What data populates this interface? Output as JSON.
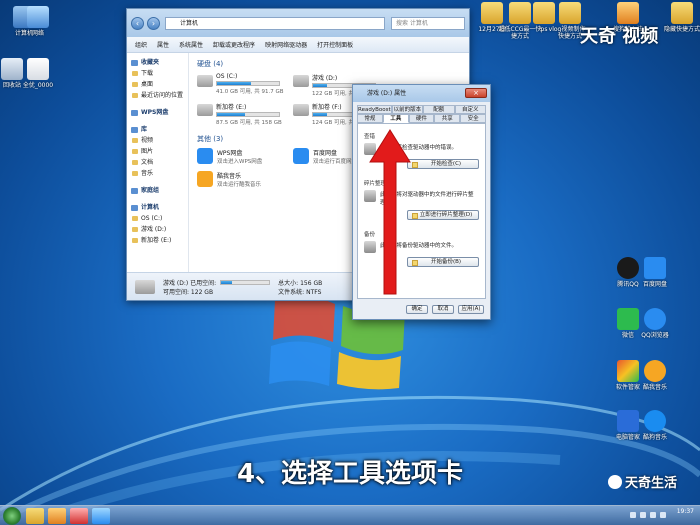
{
  "desktop": {
    "left_icons": [
      {
        "label": "计算机"
      },
      {
        "label": "网络"
      },
      {
        "label": "回收站"
      },
      {
        "label": "全优_0000"
      }
    ],
    "top_icons": [
      {
        "label": "12月27日"
      },
      {
        "label": "超低CCG最一快捷方式"
      },
      {
        "label": "ps"
      },
      {
        "label": "vlog视频制作一快捷方式"
      },
      {
        "label": "搜狗输入法"
      },
      {
        "label": "隐藏快捷方式"
      }
    ],
    "right_icons": [
      {
        "label": "腾讯QQ",
        "color": "#1a1a1a"
      },
      {
        "label": "百度网盘",
        "color": "#2a8cf0"
      },
      {
        "label": "微信",
        "color": "#2dbb4e"
      },
      {
        "label": "QQ浏览器",
        "color": "#2a8cf0"
      },
      {
        "label": "软件管家",
        "color": "#e7562e"
      },
      {
        "label": "酷我音乐",
        "color": "#f6a623"
      },
      {
        "label": "电脑管家",
        "color": "#2a6cd8"
      },
      {
        "label": "酷狗音乐",
        "color": "#1a8cf0"
      }
    ]
  },
  "explorer": {
    "address": "计算机",
    "search_placeholder": "搜索 计算机",
    "toolbar": [
      "组织",
      "属性",
      "系统属性",
      "卸载或更改程序",
      "映射网络驱动器",
      "打开控制面板"
    ],
    "sidebar": {
      "favorites_header": "收藏夹",
      "favorites": [
        "下载",
        "桌面",
        "最近访问的位置"
      ],
      "wps": "WPS网盘",
      "libraries_header": "库",
      "libraries": [
        "视频",
        "图片",
        "文档",
        "音乐"
      ],
      "homegroup": "家庭组",
      "computer_header": "计算机",
      "computer": [
        "OS (C:)",
        "游戏 (D:)",
        "新加卷 (E:)"
      ]
    },
    "drives_group": "硬盘 (4)",
    "drives": [
      {
        "name": "OS (C:)",
        "free": "41.0 GB 可用, 共 91.7 GB",
        "usage": 0.55,
        "red": false
      },
      {
        "name": "游戏 (D:)",
        "free": "122 GB 可用, 共 156 GB",
        "usage": 0.22,
        "red": false
      },
      {
        "name": "新加卷 (E:)",
        "free": "87.5 GB 可用, 共 158 GB",
        "usage": 0.45,
        "red": false
      },
      {
        "name": "新加卷 (F:)",
        "free": "124 GB 可用, 共 158 GB",
        "usage": 0.22,
        "red": false
      }
    ],
    "others_group": "其他 (3)",
    "others": [
      {
        "name": "WPS网盘",
        "sub": "双击进入WPS网盘",
        "color": "#2a8cf0"
      },
      {
        "name": "百度网盘",
        "sub": "双击运行百度网盘",
        "color": "#2a8cf0"
      },
      {
        "name": "酷我音乐",
        "sub": "双击运行酷我音乐",
        "color": "#f6a623"
      }
    ],
    "status": {
      "drive": "游戏 (D:) 已用空间:",
      "free": "可用空间: 122 GB",
      "total": "总大小: 156 GB",
      "fs": "文件系统: NTFS",
      "usage": 0.22
    }
  },
  "dialog": {
    "title": "游戏 (D:) 属性",
    "tabs_row1": [
      "ReadyBoost",
      "以前的版本",
      "配额",
      "自定义"
    ],
    "tabs_row2": [
      "常规",
      "工具",
      "硬件",
      "共享",
      "安全"
    ],
    "sections": [
      {
        "title": "查错",
        "desc": "此选项将检查驱动器中的错误。",
        "button": "开始检查(C)"
      },
      {
        "title": "碎片整理",
        "desc": "此选项将对驱动器中的文件进行碎片整理。",
        "button": "立即进行碎片整理(D)"
      },
      {
        "title": "备份",
        "desc": "此选项将备份驱动器中的文件。",
        "button": "开始备份(B)"
      }
    ],
    "ok": "确定",
    "cancel": "取消",
    "apply": "应用(A)"
  },
  "caption": "4、选择工具选项卡",
  "watermark_top": "天奇 视频",
  "watermark_bottom": "天奇生活",
  "clock": {
    "time": "19:37"
  }
}
